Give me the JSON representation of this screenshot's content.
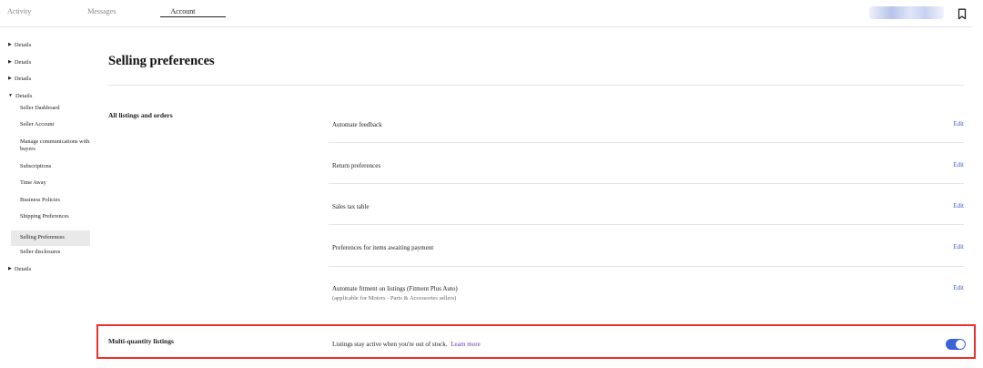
{
  "nav": {
    "tabs": [
      {
        "label": "Activity"
      },
      {
        "label": "Messages"
      },
      {
        "label": "Account"
      }
    ],
    "active_tab": "Account"
  },
  "header": {
    "bookmark_icon": "bookmark-icon"
  },
  "sidebar": {
    "collapsed_groups": [
      "Details",
      "Details",
      "Details"
    ],
    "expanded_group": "Details",
    "items": [
      "Seller Dashboard",
      "Seller Account",
      "Manage communications with buyers",
      "Subscriptions",
      "Time Away",
      "Business Policies",
      "Shipping Preferences",
      "Selling Preferences",
      "Seller disclosures"
    ],
    "selected_item": "Selling Preferences",
    "trailing_group": "Details"
  },
  "main": {
    "title": "Selling preferences",
    "section_label": "All listings and orders",
    "edit_label": "Edit",
    "preferences": [
      {
        "label": "Automate feedback"
      },
      {
        "label": "Return preferences"
      },
      {
        "label": "Sales tax table"
      },
      {
        "label": "Preferences for items awaiting payment"
      },
      {
        "label": "Automate fitment on listings (Fitment Plus Auto)",
        "sublabel": "(applicable for Motors - Parts & Accessories sellers)"
      }
    ],
    "multi_quantity": {
      "label": "Multi-quantity listings",
      "description": "Listings stay active when you're out of stock.",
      "link": "Learn more",
      "toggle_on": true
    }
  },
  "colors": {
    "highlight_border": "#e8302c",
    "link_blue": "#3a5cc5",
    "learn_more_purple": "#6b2fa8",
    "toggle_on": "#3b62d8"
  }
}
